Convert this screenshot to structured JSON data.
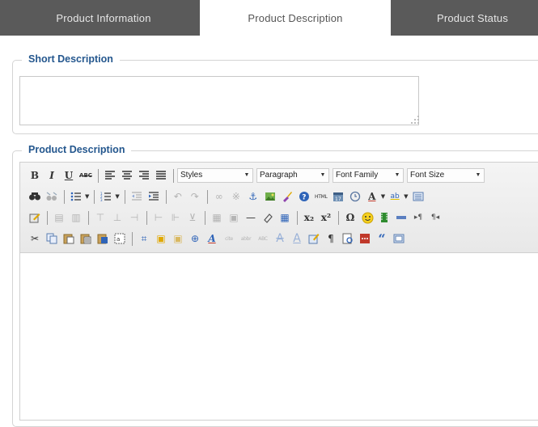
{
  "tabs": {
    "left": "Product Information",
    "middle": "Product Description",
    "right": "Product Status",
    "active": "middle"
  },
  "short_description": {
    "legend": "Short Description",
    "value": ""
  },
  "product_description": {
    "legend": "Product Description",
    "value": "",
    "toolbar": {
      "row1": {
        "bold": "B",
        "italic": "I",
        "underline": "U",
        "strikethrough": "ABC",
        "styles_select": "Styles",
        "format_select": "Paragraph",
        "font_family_select": "Font Family",
        "font_size_select": "Font Size"
      },
      "row2_icons": [
        "find-replace-icon",
        "find-icon",
        "bullet-list-icon",
        "numbered-list-icon",
        "outdent-icon",
        "indent-icon",
        "undo-icon",
        "redo-icon",
        "link-icon",
        "unlink-icon",
        "anchor-icon",
        "image-icon",
        "cleanup-icon",
        "help-icon",
        "html-source-icon",
        "insert-date-icon",
        "insert-time-icon",
        "text-color-icon",
        "highlight-color-icon",
        "preview-icon"
      ],
      "row2_labels": {
        "html": "HTML",
        "text_color": "A",
        "highlight": "ab"
      },
      "row3_labels": {
        "subscript": "x₂",
        "superscript": "x²",
        "charmap": "Ω"
      },
      "row4_labels": {
        "font_abbr": "A",
        "citation": "cite",
        "abbr": "abbr",
        "acronym": "ABC",
        "del": "A",
        "ins": "A",
        "blockquote": "“"
      }
    }
  },
  "colors": {
    "tab_bar": "#5a5a5a",
    "legend": "#24578e",
    "border": "#d4d4d4"
  }
}
